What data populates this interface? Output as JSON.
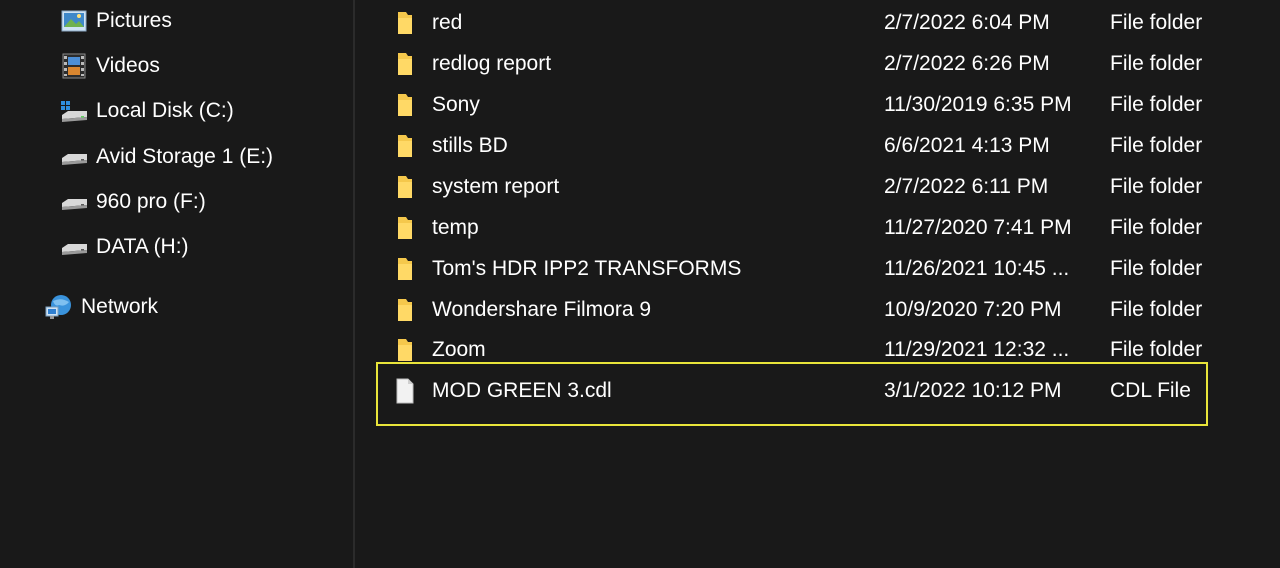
{
  "nav": {
    "items": [
      {
        "label": "Pictures",
        "icon": "pictures-icon"
      },
      {
        "label": "Videos",
        "icon": "videos-icon"
      },
      {
        "label": "Local Disk (C:)",
        "icon": "local-disk-icon"
      },
      {
        "label": "Avid Storage 1 (E:)",
        "icon": "drive-icon"
      },
      {
        "label": "960 pro (F:)",
        "icon": "drive-icon"
      },
      {
        "label": "DATA (H:)",
        "icon": "drive-icon"
      },
      {
        "label": "Network",
        "icon": "network-icon"
      }
    ]
  },
  "files": [
    {
      "name": "red",
      "date": "2/7/2022 6:04 PM",
      "type": "File folder",
      "icon": "folder-icon"
    },
    {
      "name": "redlog report",
      "date": "2/7/2022 6:26 PM",
      "type": "File folder",
      "icon": "folder-icon"
    },
    {
      "name": "Sony",
      "date": "11/30/2019 6:35 PM",
      "type": "File folder",
      "icon": "folder-icon"
    },
    {
      "name": "stills BD",
      "date": "6/6/2021 4:13 PM",
      "type": "File folder",
      "icon": "folder-icon"
    },
    {
      "name": "system report",
      "date": "2/7/2022 6:11 PM",
      "type": "File folder",
      "icon": "folder-icon"
    },
    {
      "name": "temp",
      "date": "11/27/2020 7:41 PM",
      "type": "File folder",
      "icon": "folder-icon"
    },
    {
      "name": "Tom's HDR IPP2 TRANSFORMS",
      "date": "11/26/2021 10:45 ...",
      "type": "File folder",
      "icon": "folder-icon"
    },
    {
      "name": "Wondershare Filmora 9",
      "date": "10/9/2020 7:20 PM",
      "type": "File folder",
      "icon": "folder-icon"
    },
    {
      "name": "Zoom",
      "date": "11/29/2021 12:32 ...",
      "type": "File folder",
      "icon": "folder-icon"
    },
    {
      "name": "MOD GREEN 3.cdl",
      "date": "3/1/2022 10:12 PM",
      "type": "CDL File",
      "icon": "file-icon"
    }
  ],
  "colors": {
    "background": "#191919",
    "text": "#ffffff",
    "folder": "#f5c84c",
    "highlight_border": "#e8e43a"
  }
}
